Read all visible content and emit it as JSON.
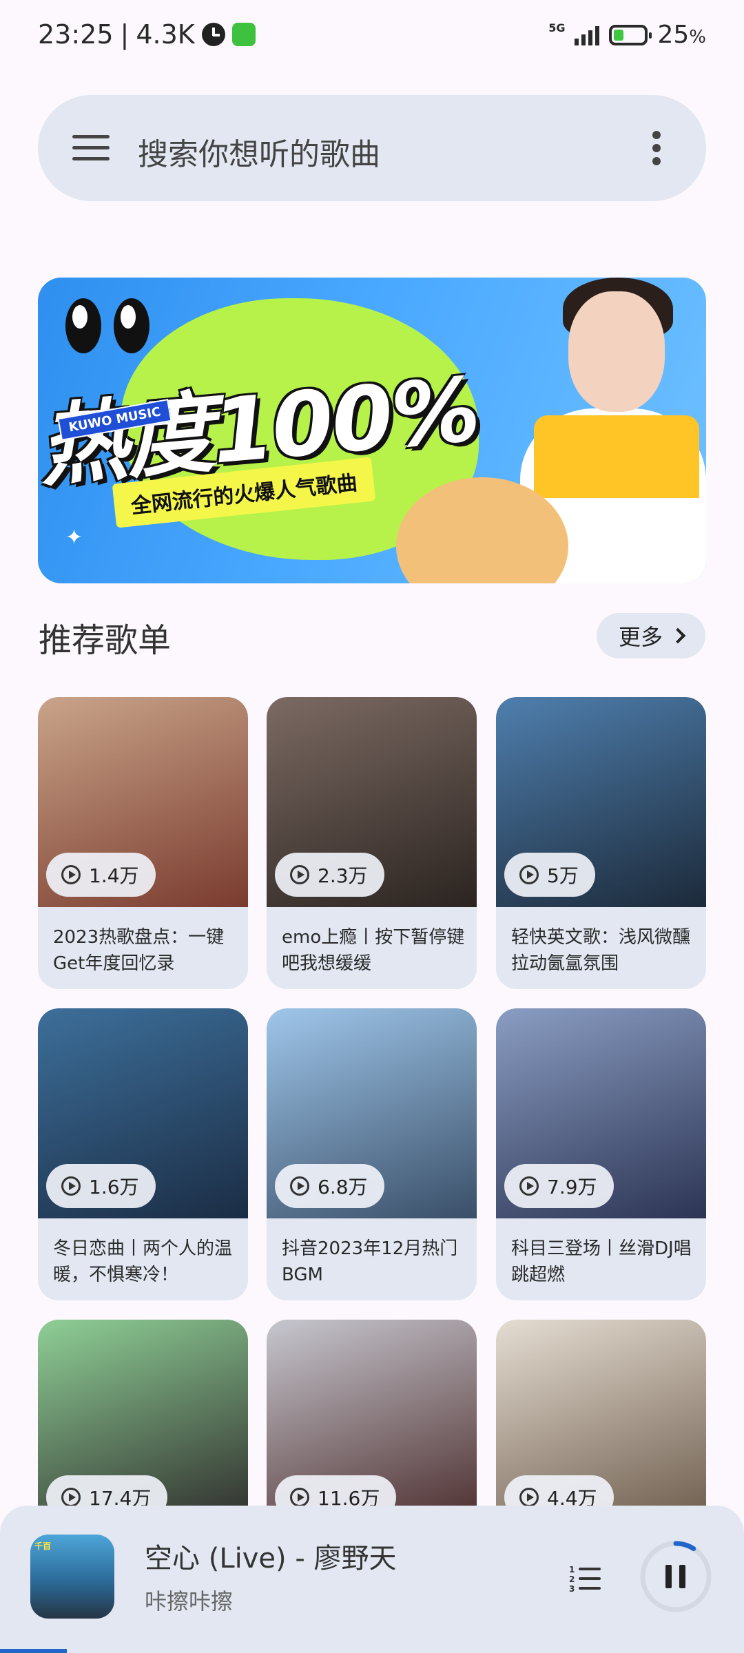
{
  "status_bar": {
    "time": "23:25",
    "separator": "|",
    "net_speed": "4.3K",
    "network_type": "5G",
    "battery": "25",
    "battery_unit": "%",
    "icons": [
      "clock-icon",
      "app-notification-icon",
      "signal-icon",
      "battery-icon"
    ]
  },
  "search": {
    "placeholder": "搜索你想听的歌曲",
    "icons": [
      "menu-icon",
      "more-vert-icon"
    ]
  },
  "banner": {
    "logo": "KUWO MUSIC",
    "title": "热度100%",
    "subtitle": "全网流行的火爆人气歌曲"
  },
  "section": {
    "title": "推荐歌单",
    "more_label": "更多"
  },
  "playlists": [
    {
      "plays": "1.4万",
      "title": "2023热歌盘点：一键Get年度回忆录",
      "colors": [
        "#c9a48a",
        "#7a3b2e"
      ]
    },
    {
      "plays": "2.3万",
      "title": "emo上瘾丨按下暂停键吧我想缓缓",
      "colors": [
        "#7c6a63",
        "#2b2420"
      ]
    },
    {
      "plays": "5万",
      "title": "轻快英文歌：浅风微醺拉动氤氲氛围",
      "colors": [
        "#4f7fae",
        "#1c2a3a"
      ]
    },
    {
      "plays": "1.6万",
      "title": "冬日恋曲丨两个人的温暖，不惧寒冷！",
      "colors": [
        "#3d6f9a",
        "#1b2d45"
      ]
    },
    {
      "plays": "6.8万",
      "title": "抖音2023年12月热门BGM",
      "colors": [
        "#9fc6ea",
        "#3a4f68"
      ]
    },
    {
      "plays": "7.9万",
      "title": "科目三登场丨丝滑DJ唱跳超燃",
      "colors": [
        "#8a9dc2",
        "#2c3454"
      ]
    },
    {
      "plays": "17.4万",
      "title": "",
      "colors": [
        "#8fcf96",
        "#2d2a2a"
      ]
    },
    {
      "plays": "11.6万",
      "title": "",
      "colors": [
        "#c7c7cf",
        "#4a2b2b"
      ]
    },
    {
      "plays": "4.4万",
      "title": "",
      "colors": [
        "#e5ddd2",
        "#6b5a4a"
      ]
    }
  ],
  "player": {
    "title": "空心 (Live) - 廖野天",
    "artist": "咔擦咔擦",
    "cover_tag": "千百",
    "progress": 0.09
  }
}
